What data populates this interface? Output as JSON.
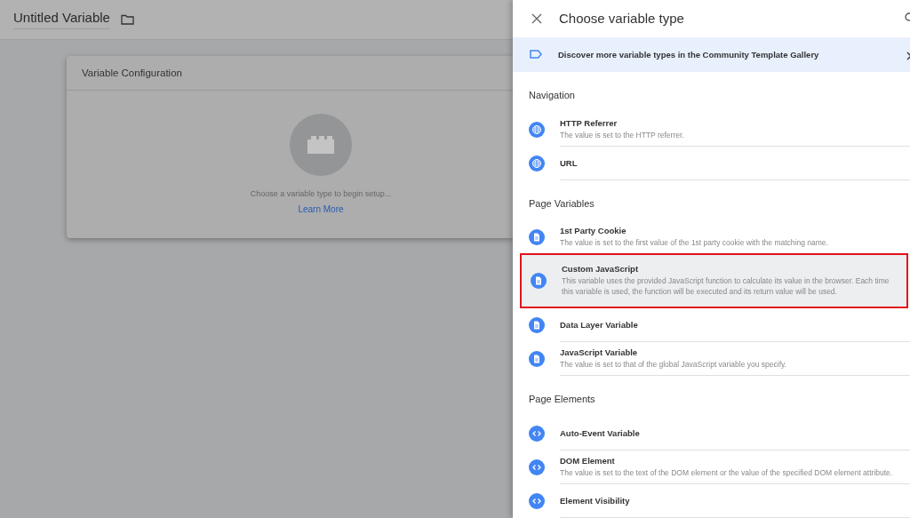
{
  "editor": {
    "title": "Untitled Variable",
    "card": {
      "title": "Variable Configuration",
      "hint": "Choose a variable type to begin setup...",
      "link": "Learn More"
    }
  },
  "panel": {
    "title": "Choose variable type",
    "banner": "Discover more variable types in the Community Template Gallery",
    "sections": [
      {
        "title": "Navigation",
        "items": [
          {
            "kind": "globe",
            "name": "HTTP Referrer",
            "description": "The value is set to the HTTP referrer.",
            "selected": false
          },
          {
            "kind": "globe",
            "name": "URL",
            "selected": false
          }
        ]
      },
      {
        "title": "Page Variables",
        "items": [
          {
            "kind": "doc",
            "name": "1st Party Cookie",
            "description": "The value is set to the first value of the 1st party cookie with the matching name.",
            "selected": false
          },
          {
            "kind": "doc",
            "name": "Custom JavaScript",
            "description": "This variable uses the provided JavaScript function to calculate its value in the browser. Each time this variable is used, the function will be executed and its return value will be used.",
            "selected": true
          },
          {
            "kind": "doc",
            "name": "Data Layer Variable",
            "selected": false
          },
          {
            "kind": "doc",
            "name": "JavaScript Variable",
            "description": "The value is set to that of the global JavaScript variable you specify.",
            "selected": false
          }
        ]
      },
      {
        "title": "Page Elements",
        "items": [
          {
            "kind": "code",
            "name": "Auto-Event Variable",
            "selected": false
          },
          {
            "kind": "code",
            "name": "DOM Element",
            "description": "The value is set to the text of the DOM element or the value of the specified DOM element attribute.",
            "selected": false
          },
          {
            "kind": "code",
            "name": "Element Visibility",
            "selected": false
          }
        ]
      }
    ]
  }
}
